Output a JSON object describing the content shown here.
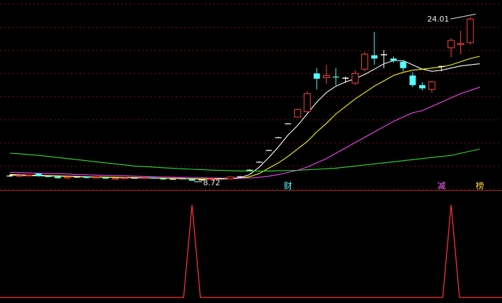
{
  "chart_data": [
    {
      "type": "candlestick",
      "title": "",
      "ylim": [
        7.8,
        25.2
      ],
      "grid": true,
      "x": [
        1,
        2,
        3,
        4,
        5,
        6,
        7,
        8,
        9,
        10,
        11,
        12,
        13,
        14,
        15,
        16,
        17,
        18,
        19,
        20,
        21,
        22,
        23,
        24,
        25,
        26,
        27,
        28,
        29,
        30,
        31,
        32,
        33,
        34,
        35,
        36,
        37,
        38,
        39,
        40,
        41,
        42,
        43,
        44,
        45,
        46,
        47,
        48,
        49,
        50
      ],
      "candles": [
        {
          "o": 9.1,
          "h": 9.2,
          "l": 9.0,
          "c": 9.08,
          "color": "#ffffff"
        },
        {
          "o": 9.05,
          "h": 9.15,
          "l": 8.98,
          "c": 9.12,
          "color": "#ff4040"
        },
        {
          "o": 9.12,
          "h": 9.2,
          "l": 9.02,
          "c": 9.15,
          "color": "#ff4040"
        },
        {
          "o": 9.3,
          "h": 9.36,
          "l": 9.0,
          "c": 9.05,
          "color": "#54ffff"
        },
        {
          "o": 9.05,
          "h": 9.12,
          "l": 8.95,
          "c": 9.0,
          "color": "#54ffff"
        },
        {
          "o": 9.0,
          "h": 9.05,
          "l": 8.82,
          "c": 8.86,
          "color": "#54ffff"
        },
        {
          "o": 8.88,
          "h": 9.0,
          "l": 8.8,
          "c": 8.98,
          "color": "#ff4040"
        },
        {
          "o": 8.98,
          "h": 9.05,
          "l": 8.9,
          "c": 9.0,
          "color": "#ffffff"
        },
        {
          "o": 9.0,
          "h": 9.03,
          "l": 8.85,
          "c": 8.88,
          "color": "#54ffff"
        },
        {
          "o": 8.88,
          "h": 8.98,
          "l": 8.85,
          "c": 8.95,
          "color": "#ff4040"
        },
        {
          "o": 8.92,
          "h": 8.96,
          "l": 8.8,
          "c": 8.82,
          "color": "#54ffff"
        },
        {
          "o": 8.82,
          "h": 8.9,
          "l": 8.78,
          "c": 8.85,
          "color": "#ff4040"
        },
        {
          "o": 8.85,
          "h": 8.95,
          "l": 8.8,
          "c": 8.9,
          "color": "#ff4040"
        },
        {
          "o": 8.9,
          "h": 8.92,
          "l": 8.85,
          "c": 8.88,
          "color": "#ffffff"
        },
        {
          "o": 8.9,
          "h": 8.95,
          "l": 8.8,
          "c": 8.85,
          "color": "#ff4040"
        },
        {
          "o": 8.92,
          "h": 8.96,
          "l": 8.8,
          "c": 8.82,
          "color": "#54ffff"
        },
        {
          "o": 8.82,
          "h": 8.86,
          "l": 8.7,
          "c": 8.75,
          "color": "#54ffff"
        },
        {
          "o": 8.78,
          "h": 8.86,
          "l": 8.74,
          "c": 8.8,
          "color": "#ffffff"
        },
        {
          "o": 8.8,
          "h": 8.86,
          "l": 8.76,
          "c": 8.84,
          "color": "#ffffff"
        },
        {
          "o": 8.78,
          "h": 8.8,
          "l": 8.6,
          "c": 8.62,
          "color": "#54ffff"
        },
        {
          "o": 8.66,
          "h": 8.8,
          "l": 8.6,
          "c": 8.75,
          "color": "#ffffff"
        },
        {
          "o": 8.76,
          "h": 8.9,
          "l": 8.72,
          "c": 8.82,
          "color": "#ff4040"
        },
        {
          "o": 8.82,
          "h": 8.88,
          "l": 8.76,
          "c": 8.84,
          "color": "#ffffff"
        },
        {
          "o": 8.8,
          "h": 9.0,
          "l": 8.76,
          "c": 8.98,
          "color": "#ff4040"
        },
        {
          "o": 8.98,
          "h": 9.08,
          "l": 8.95,
          "c": 9.02,
          "color": "#ffffff"
        },
        {
          "o": 9.65,
          "h": 9.7,
          "l": 9.6,
          "c": 9.65,
          "color": "#ffffff"
        },
        {
          "o": 10.4,
          "h": 10.45,
          "l": 10.35,
          "c": 10.4,
          "color": "#ffffff"
        },
        {
          "o": 11.5,
          "h": 11.55,
          "l": 11.45,
          "c": 11.5,
          "color": "#ffffff"
        },
        {
          "o": 12.7,
          "h": 12.75,
          "l": 12.65,
          "c": 12.7,
          "color": "#ffffff"
        },
        {
          "o": 14.0,
          "h": 14.05,
          "l": 13.95,
          "c": 14.0,
          "color": "#ffffff"
        },
        {
          "o": 14.6,
          "h": 15.4,
          "l": 14.6,
          "c": 15.3,
          "color": "#ff4040"
        },
        {
          "o": 15.1,
          "h": 17.0,
          "l": 15.1,
          "c": 16.8,
          "color": "#ff4040"
        },
        {
          "o": 18.7,
          "h": 19.2,
          "l": 17.2,
          "c": 18.2,
          "color": "#54ffff"
        },
        {
          "o": 18.3,
          "h": 19.5,
          "l": 17.7,
          "c": 18.5,
          "color": "#ff4040"
        },
        {
          "o": 18.4,
          "h": 19.2,
          "l": 17.6,
          "c": 18.4,
          "color": "#54ffff"
        },
        {
          "o": 18.2,
          "h": 18.4,
          "l": 17.8,
          "c": 18.3,
          "color": "#ffffff"
        },
        {
          "o": 17.8,
          "h": 19.0,
          "l": 17.6,
          "c": 18.7,
          "color": "#ff4040"
        },
        {
          "o": 19.1,
          "h": 20.7,
          "l": 18.9,
          "c": 20.5,
          "color": "#ff4040"
        },
        {
          "o": 20.4,
          "h": 22.6,
          "l": 19.5,
          "c": 20.1,
          "color": "#54ffff"
        },
        {
          "o": 20.5,
          "h": 20.9,
          "l": 19.2,
          "c": 20.4,
          "color": "#ffffff"
        },
        {
          "o": 20.1,
          "h": 20.3,
          "l": 19.7,
          "c": 19.9,
          "color": "#54ffff"
        },
        {
          "o": 19.8,
          "h": 19.9,
          "l": 18.9,
          "c": 19.2,
          "color": "#54ffff"
        },
        {
          "o": 18.5,
          "h": 18.8,
          "l": 17.4,
          "c": 17.6,
          "color": "#54ffff"
        },
        {
          "o": 17.6,
          "h": 17.9,
          "l": 17.1,
          "c": 17.3,
          "color": "#54ffff"
        },
        {
          "o": 17.2,
          "h": 18.0,
          "l": 16.9,
          "c": 17.9,
          "color": "#ff4040"
        },
        {
          "o": 19.4,
          "h": 19.4,
          "l": 18.9,
          "c": 19.4,
          "color": "#ffffff"
        },
        {
          "o": 21.1,
          "h": 22.0,
          "l": 20.2,
          "c": 21.8,
          "color": "#ff4040"
        },
        {
          "o": 21.4,
          "h": 22.7,
          "l": 20.5,
          "c": 21.5,
          "color": "#ff4040"
        },
        {
          "o": 21.6,
          "h": 24.01,
          "l": 21.4,
          "c": 23.8,
          "color": "#ff4040"
        }
      ],
      "ma_lines": [
        {
          "name": "",
          "color": "#ffffff",
          "values": [
            9.2,
            9.18,
            9.15,
            9.13,
            9.1,
            9.08,
            9.05,
            9.02,
            9.0,
            8.98,
            8.96,
            8.95,
            8.93,
            8.92,
            8.9,
            8.88,
            8.86,
            8.84,
            8.82,
            8.8,
            8.78,
            8.8,
            8.82,
            8.86,
            8.9,
            9.2,
            9.9,
            10.8,
            11.8,
            12.9,
            13.8,
            14.9,
            16.0,
            16.9,
            17.5,
            17.9,
            18.2,
            18.6,
            19.1,
            19.6,
            19.9,
            19.9,
            19.5,
            19.1,
            18.9,
            19.0,
            19.2,
            19.4,
            19.5,
            19.6
          ]
        },
        {
          "name": "",
          "color": "#ffff00",
          "values": [
            9.15,
            9.12,
            9.1,
            9.08,
            9.06,
            9.05,
            9.03,
            9.0,
            8.98,
            8.96,
            8.95,
            8.93,
            8.91,
            8.9,
            8.88,
            8.87,
            8.85,
            8.84,
            8.82,
            8.8,
            8.79,
            8.78,
            8.78,
            8.8,
            8.85,
            9.0,
            9.3,
            9.8,
            10.3,
            10.9,
            11.6,
            12.3,
            13.2,
            14.0,
            14.9,
            15.6,
            16.3,
            16.9,
            17.5,
            18.0,
            18.5,
            18.8,
            19.0,
            19.1,
            19.2,
            19.3,
            19.5,
            19.8,
            20.1,
            20.3
          ]
        },
        {
          "name": "",
          "color": "#ff44ff",
          "values": [
            9.4,
            9.38,
            9.35,
            9.32,
            9.3,
            9.28,
            9.25,
            9.2,
            9.18,
            9.15,
            9.12,
            9.1,
            9.08,
            9.05,
            9.02,
            9.0,
            8.98,
            8.96,
            8.94,
            8.92,
            8.9,
            8.88,
            8.86,
            8.85,
            8.85,
            8.88,
            8.95,
            9.05,
            9.2,
            9.4,
            9.6,
            9.9,
            10.3,
            10.7,
            11.2,
            11.7,
            12.2,
            12.7,
            13.2,
            13.7,
            14.2,
            14.6,
            15.0,
            15.2,
            15.6,
            16.0,
            16.4,
            16.8,
            17.1,
            17.4
          ]
        },
        {
          "name": "",
          "color": "#33dd33",
          "values": [
            11.2,
            11.15,
            11.08,
            11.0,
            10.9,
            10.8,
            10.7,
            10.6,
            10.5,
            10.4,
            10.3,
            10.2,
            10.1,
            10.0,
            9.95,
            9.9,
            9.84,
            9.79,
            9.74,
            9.7,
            9.66,
            9.62,
            9.59,
            9.56,
            9.54,
            9.53,
            9.53,
            9.53,
            9.55,
            9.58,
            9.6,
            9.65,
            9.7,
            9.75,
            9.8,
            9.9,
            10.0,
            10.1,
            10.2,
            10.3,
            10.4,
            10.5,
            10.6,
            10.7,
            10.8,
            10.9,
            11.0,
            11.2,
            11.4,
            11.6
          ]
        }
      ],
      "annotations": [
        {
          "text": "24.01",
          "x": 50,
          "y": 24.01
        },
        {
          "text": "8.72",
          "x": 20,
          "y": 8.72
        }
      ]
    },
    {
      "type": "line",
      "title": "",
      "ylim": [
        0,
        1
      ],
      "series": [
        {
          "name": "",
          "color": "#ff3030",
          "values": [
            0,
            0,
            0,
            0,
            0,
            0,
            0,
            0,
            0,
            0,
            0,
            0,
            0,
            0,
            0,
            0,
            0,
            0,
            0,
            1,
            0,
            0,
            0,
            0,
            0,
            0,
            0,
            0,
            0,
            0,
            0,
            0,
            0,
            0,
            0,
            0,
            0,
            0,
            0,
            0,
            0,
            0,
            0,
            0,
            0,
            0,
            1,
            0,
            0,
            0
          ]
        }
      ],
      "markers": [
        {
          "text": "财",
          "x": 30,
          "color": "#54ffff"
        },
        {
          "text": "减",
          "x": 46,
          "color": "#ff66ff"
        },
        {
          "text": "榜",
          "x": 50,
          "color": "#ffdd33"
        }
      ]
    }
  ]
}
